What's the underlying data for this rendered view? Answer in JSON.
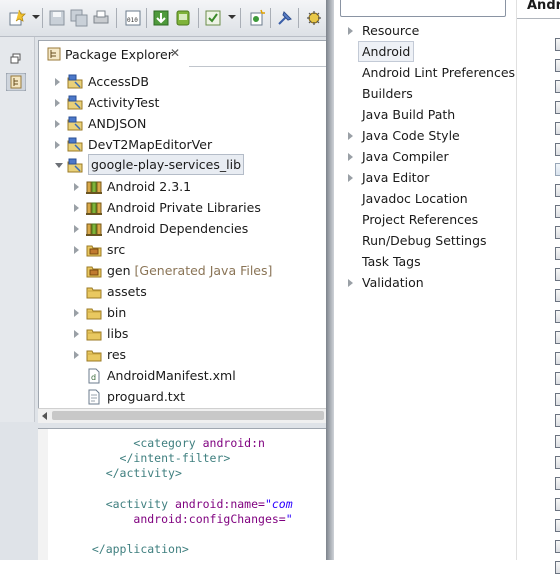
{
  "package_explorer": {
    "title": "Package Explorer",
    "close_glyph": "✕",
    "tree": [
      {
        "label": "AccessDB",
        "level": 0,
        "expanded": false,
        "icon": "project-icon"
      },
      {
        "label": "ActivityTest",
        "level": 0,
        "expanded": false,
        "icon": "project-icon"
      },
      {
        "label": "ANDJSON",
        "level": 0,
        "expanded": false,
        "icon": "project-icon"
      },
      {
        "label": "DevT2MapEditorVer",
        "level": 0,
        "expanded": false,
        "icon": "project-icon"
      },
      {
        "label": "google-play-services_lib",
        "level": 0,
        "expanded": true,
        "icon": "project-icon",
        "selected": true
      },
      {
        "label": "Android 2.3.1",
        "level": 1,
        "expanded": false,
        "icon": "library-icon"
      },
      {
        "label": "Android Private Libraries",
        "level": 1,
        "expanded": false,
        "icon": "library-icon"
      },
      {
        "label": "Android Dependencies",
        "level": 1,
        "expanded": false,
        "icon": "library-icon"
      },
      {
        "label": "src",
        "level": 1,
        "expanded": false,
        "icon": "source-folder-icon"
      },
      {
        "label": "gen",
        "level": 1,
        "icon": "source-folder-icon",
        "suffix": "[Generated Java Files]"
      },
      {
        "label": "assets",
        "level": 1,
        "icon": "folder-icon"
      },
      {
        "label": "bin",
        "level": 1,
        "expanded": false,
        "icon": "folder-icon"
      },
      {
        "label": "libs",
        "level": 1,
        "expanded": false,
        "icon": "folder-icon"
      },
      {
        "label": "res",
        "level": 1,
        "expanded": false,
        "icon": "folder-icon"
      },
      {
        "label": "AndroidManifest.xml",
        "level": 1,
        "icon": "xml-file-icon"
      },
      {
        "label": "proguard.txt",
        "level": 1,
        "icon": "text-file-icon"
      }
    ]
  },
  "editor": {
    "lines": [
      {
        "indent": "        ",
        "tag": "<category",
        "attr": " android:n",
        "value": ""
      },
      {
        "indent": "      ",
        "tag": "</intent-filter>",
        "attr": "",
        "value": ""
      },
      {
        "indent": "    ",
        "tag": "</activity>",
        "attr": "",
        "value": ""
      },
      {
        "indent": "",
        "tag": "",
        "attr": "",
        "value": ""
      },
      {
        "indent": "    ",
        "tag": "<activity",
        "attr": " android:name=",
        "value": "\"com"
      },
      {
        "indent": "        ",
        "tag": "",
        "attr": "android:configChanges=",
        "value": "\""
      },
      {
        "indent": "",
        "tag": "",
        "attr": "",
        "value": ""
      },
      {
        "indent": "  ",
        "tag": "</application>",
        "attr": "",
        "value": ""
      }
    ]
  },
  "properties_dialog": {
    "nav": [
      {
        "label": "Resource",
        "expandable": true
      },
      {
        "label": "Android",
        "expandable": false,
        "selected": true
      },
      {
        "label": "Android Lint Preferences",
        "expandable": false
      },
      {
        "label": "Builders",
        "expandable": false
      },
      {
        "label": "Java Build Path",
        "expandable": false
      },
      {
        "label": "Java Code Style",
        "expandable": true
      },
      {
        "label": "Java Compiler",
        "expandable": true
      },
      {
        "label": "Java Editor",
        "expandable": true
      },
      {
        "label": "Javadoc Location",
        "expandable": false
      },
      {
        "label": "Project References",
        "expandable": false
      },
      {
        "label": "Run/Debug Settings",
        "expandable": false
      },
      {
        "label": "Task Tags",
        "expandable": false
      },
      {
        "label": "Validation",
        "expandable": true
      }
    ],
    "page_title": "Andro"
  }
}
